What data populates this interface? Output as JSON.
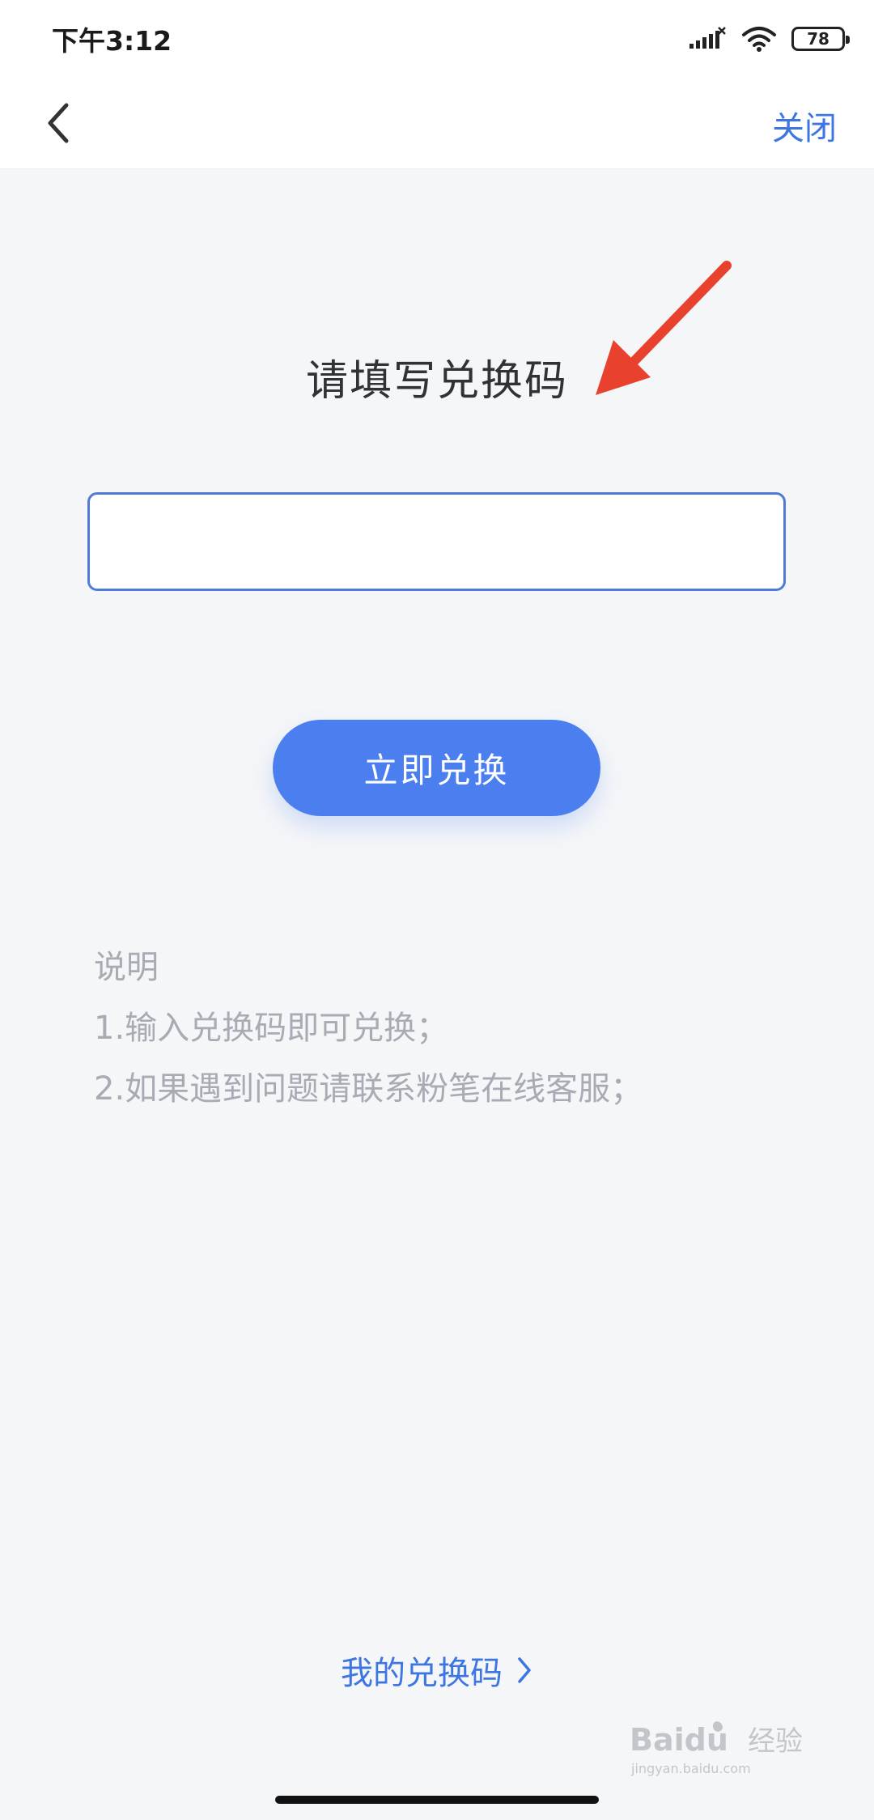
{
  "status_bar": {
    "time": "下午3:12",
    "battery_level": "78"
  },
  "nav": {
    "back_icon": "chevron-left-icon",
    "close_label": "关闭"
  },
  "form": {
    "title": "请填写兑换码",
    "input_value": "",
    "input_placeholder": "",
    "submit_label": "立即兑换"
  },
  "instructions": {
    "heading": "说明",
    "items": [
      "1.输入兑换码即可兑换；",
      "2.如果遇到问题请联系粉笔在线客服；"
    ]
  },
  "footer": {
    "my_codes_label": "我的兑换码",
    "my_codes_icon": "chevron-right-icon"
  },
  "watermark": {
    "brand": "Baidu",
    "brand_suffix": "经验",
    "site": "jingyan.baidu.com"
  },
  "colors": {
    "accent": "#3d76e0",
    "button": "#4b7ff0",
    "annotation_arrow": "#e8422f",
    "background": "#f5f6f8"
  }
}
